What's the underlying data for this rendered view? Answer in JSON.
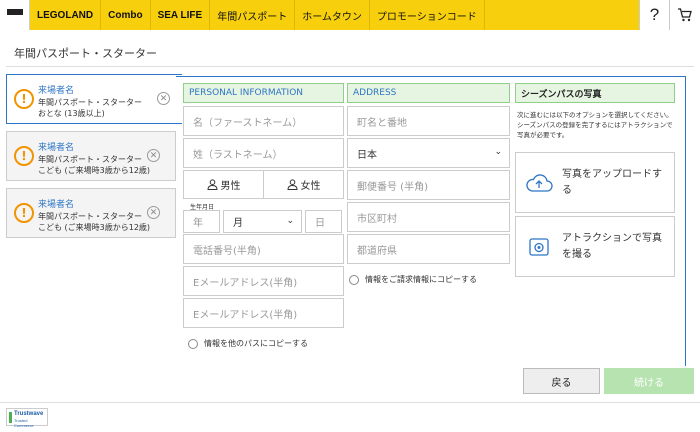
{
  "nav": {
    "items": [
      "LEGOLAND",
      "Combo",
      "SEA LIFE",
      "年間パスポート",
      "ホームタウン",
      "プロモーションコード"
    ],
    "help_label": "?"
  },
  "page": {
    "title": "年間パスポート・スターター"
  },
  "visitors": [
    {
      "name": "来場者名",
      "type": "年間パスポート・スターター",
      "age": "おとな (13歳以上)",
      "warn": "!"
    },
    {
      "name": "来場者名",
      "type": "年間パスポート・スターター",
      "age": "こども (ご来場時3歳から12歳)",
      "warn": "!"
    },
    {
      "name": "来場者名",
      "type": "年間パスポート・スターター",
      "age": "こども (ご来場時3歳から12歳)",
      "warn": "!"
    }
  ],
  "personal": {
    "heading": "PERSONAL INFORMATION",
    "first_name_placeholder": "名（ファーストネーム）",
    "last_name_placeholder": "姓（ラストネーム）",
    "male_label": "男性",
    "female_label": "女性",
    "dob_label": "生年月日",
    "year_placeholder": "年",
    "month_value": "月",
    "day_placeholder": "日",
    "phone_placeholder": "電話番号(半角)",
    "email_placeholder": "Eメールアドレス(半角)",
    "email_confirm_placeholder": "Eメールアドレス(半角)",
    "copy_to_other_label": "情報を他のパスにコピーする"
  },
  "address": {
    "heading": "ADDRESS",
    "street_placeholder": "町名と番地",
    "country_value": "日本",
    "postal_placeholder": "郵便番号 (半角)",
    "city_placeholder": "市区町村",
    "prefecture_placeholder": "都道府県",
    "copy_billing_label": "情報をご請求情報にコピーする"
  },
  "photo": {
    "heading": "シーズンパスの写真",
    "note": "次に進むには以下のオプションを選択してください。シーズンパスの登録を完了するにはアトラクションで写真が必要です。",
    "upload_label": "写真をアップロードする",
    "take_label": "アトラクションで写真を撮る"
  },
  "actions": {
    "back_label": "戻る",
    "next_label": "続ける"
  },
  "footer": {
    "trust_line1": "Trustwave",
    "trust_line2": "Trusted Commerce"
  },
  "colors": {
    "brand_yellow": "#f7cf0d",
    "link_blue": "#2e76c5",
    "warning_orange": "#f29400",
    "section_green": "#e6f4e2",
    "next_disabled_green": "#b7e3b0"
  }
}
